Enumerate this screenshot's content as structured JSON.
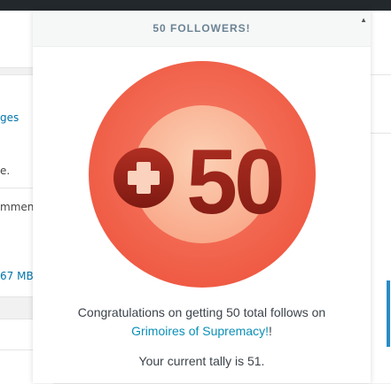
{
  "background": {
    "items": [
      {
        "text": "ges",
        "link": true
      },
      {
        "text": "e.",
        "link": false
      },
      {
        "text": "mmen",
        "link": false
      },
      {
        "text": "67 MB",
        "link": true
      }
    ]
  },
  "modal": {
    "title": "50 FOLLOWERS!",
    "badge": {
      "number": "50"
    },
    "message_prefix": "Congratulations on getting 50 total follows on",
    "site_name": "Grimoires of Supremacy!",
    "message_suffix": "!",
    "tally": "Your current tally is 51."
  },
  "colors": {
    "badge_outer": "#f2684f",
    "badge_inner": "#fbc2a3",
    "badge_numeral": "#8f1f16",
    "link": "#0a8fb8",
    "title": "#6b8393",
    "scrollbar_accent": "#2a8bc7"
  }
}
